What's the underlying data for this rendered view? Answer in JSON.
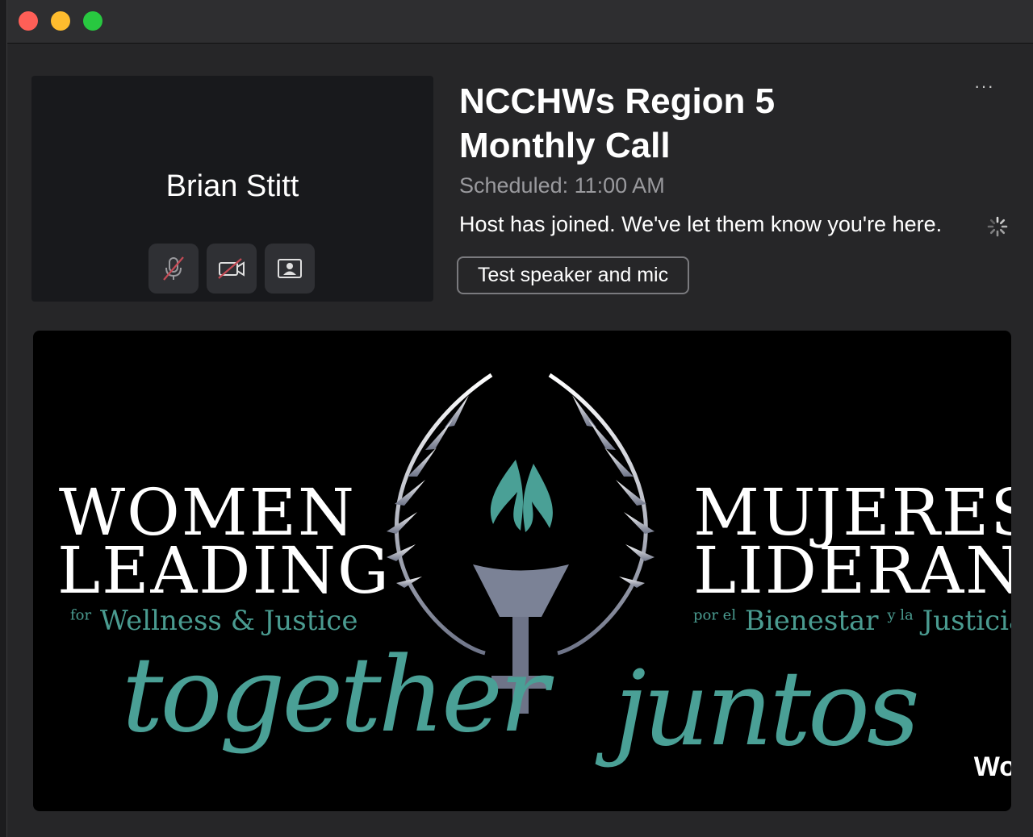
{
  "participant": {
    "name": "Brian Stitt"
  },
  "meeting": {
    "title_line1": "NCCHWs Region 5",
    "title_line2": "Monthly Call",
    "scheduled": "Scheduled: 11:00 AM",
    "status": "Host has joined. We've let them know you're here.",
    "more": "···"
  },
  "buttons": {
    "test_speaker": "Test speaker and mic"
  },
  "controls": [
    {
      "name": "mic-muted-button",
      "icon": "mic-off-icon"
    },
    {
      "name": "camera-off-button",
      "icon": "camera-off-icon"
    },
    {
      "name": "background-button",
      "icon": "person-frame-icon"
    }
  ],
  "banner": {
    "women": "WOMEN",
    "leading": "LEADING",
    "sub_en_prefix": "for",
    "sub_en": "Wellness & Justice",
    "mujeres": "MUJERES",
    "liderand": "LIDERAND",
    "sub_es_prefix": "por el",
    "sub_es_main": "Bienestar",
    "sub_es_mid": "y la",
    "sub_es_end": "Justicia",
    "together": "together",
    "juntos": "juntos",
    "wo": "Wo"
  },
  "colors": {
    "accent_teal": "#4aa096",
    "muted_red": "#c44a55",
    "background": "#262628"
  }
}
